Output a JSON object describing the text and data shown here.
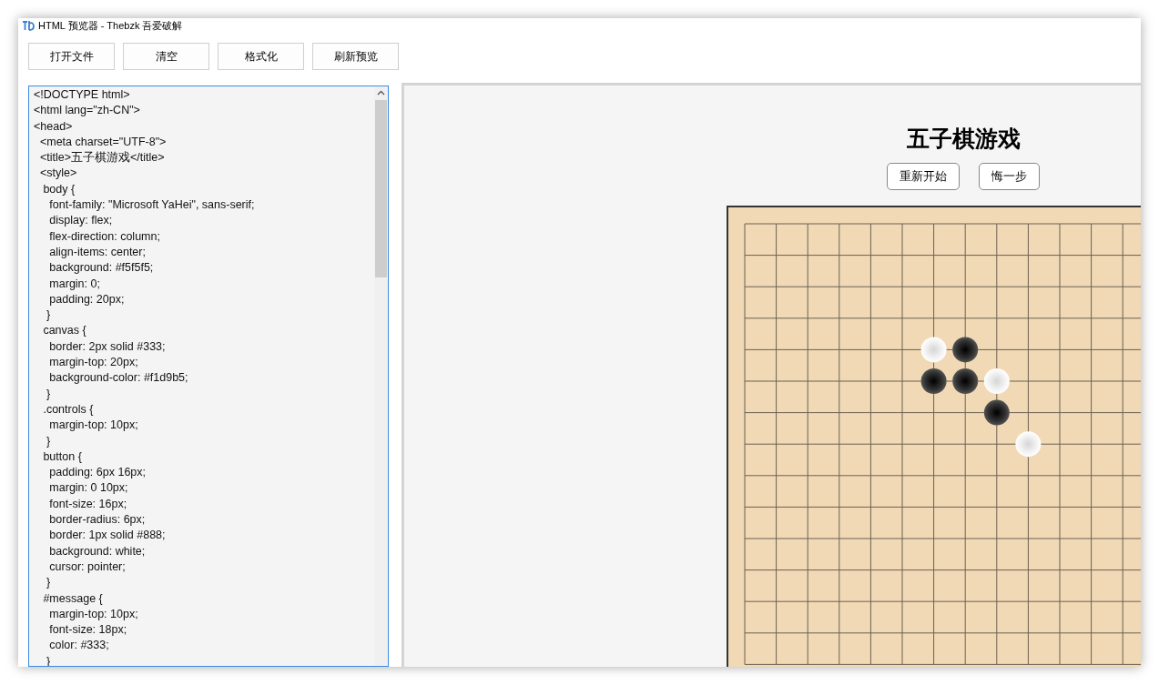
{
  "window": {
    "title": "HTML 预览器 - Thebzk 吾爱破解"
  },
  "toolbar": [
    "打开文件",
    "清空",
    "格式化",
    "刷新预览"
  ],
  "editor": {
    "lines": [
      "<!DOCTYPE html>",
      "<html lang=\"zh-CN\">",
      "<head>",
      "  <meta charset=\"UTF-8\">",
      "  <title>五子棋游戏</title>",
      "  <style>",
      "   body {",
      "     font-family: \"Microsoft YaHei\", sans-serif;",
      "     display: flex;",
      "     flex-direction: column;",
      "     align-items: center;",
      "     background: #f5f5f5;",
      "     margin: 0;",
      "     padding: 20px;",
      "    }",
      "   canvas {",
      "     border: 2px solid #333;",
      "     margin-top: 20px;",
      "     background-color: #f1d9b5;",
      "    }",
      "   .controls {",
      "     margin-top: 10px;",
      "    }",
      "   button {",
      "     padding: 6px 16px;",
      "     margin: 0 10px;",
      "     font-size: 16px;",
      "     border-radius: 6px;",
      "     border: 1px solid #888;",
      "     background: white;",
      "     cursor: pointer;",
      "    }",
      "   #message {",
      "     margin-top: 10px;",
      "     font-size: 18px;",
      "     color: #333;",
      "    }"
    ]
  },
  "preview": {
    "heading": "五子棋游戏",
    "buttons": [
      "重新开始",
      "悔一步"
    ],
    "board": [
      [
        {
          "kind": "empty"
        },
        {
          "kind": "empty"
        },
        {
          "kind": "empty"
        },
        {
          "kind": "empty"
        },
        {
          "kind": "empty"
        },
        {
          "kind": "empty"
        },
        {
          "kind": "empty"
        },
        {
          "kind": "empty"
        },
        {
          "kind": "empty"
        },
        {
          "kind": "empty"
        },
        {
          "kind": "empty"
        },
        {
          "kind": "empty"
        },
        {
          "kind": "empty"
        }
      ],
      [
        {
          "kind": "empty"
        },
        {
          "kind": "empty"
        },
        {
          "kind": "empty"
        },
        {
          "kind": "empty"
        },
        {
          "kind": "empty"
        },
        {
          "kind": "empty"
        },
        {
          "kind": "empty"
        },
        {
          "kind": "empty"
        },
        {
          "kind": "empty"
        },
        {
          "kind": "empty"
        },
        {
          "kind": "empty"
        },
        {
          "kind": "empty"
        },
        {
          "kind": "empty"
        }
      ],
      [
        {
          "kind": "empty"
        },
        {
          "kind": "empty"
        },
        {
          "kind": "empty"
        },
        {
          "kind": "empty"
        },
        {
          "kind": "empty"
        },
        {
          "kind": "empty"
        },
        {
          "kind": "empty"
        },
        {
          "kind": "empty"
        },
        {
          "kind": "empty"
        },
        {
          "kind": "empty"
        },
        {
          "kind": "empty"
        },
        {
          "kind": "empty"
        },
        {
          "kind": "empty"
        }
      ],
      [
        {
          "kind": "empty"
        },
        {
          "kind": "empty"
        },
        {
          "kind": "empty"
        },
        {
          "kind": "empty"
        },
        {
          "kind": "empty"
        },
        {
          "kind": "empty"
        },
        {
          "kind": "empty"
        },
        {
          "kind": "empty"
        },
        {
          "kind": "empty"
        },
        {
          "kind": "empty"
        },
        {
          "kind": "empty"
        },
        {
          "kind": "empty"
        },
        {
          "kind": "empty"
        }
      ],
      [
        {
          "kind": "empty"
        },
        {
          "kind": "empty"
        },
        {
          "kind": "empty"
        },
        {
          "kind": "empty"
        },
        {
          "kind": "empty"
        },
        {
          "kind": "empty"
        },
        {
          "kind": "white"
        },
        {
          "kind": "black"
        },
        {
          "kind": "empty"
        },
        {
          "kind": "empty"
        },
        {
          "kind": "empty"
        },
        {
          "kind": "empty"
        },
        {
          "kind": "empty"
        }
      ],
      [
        {
          "kind": "empty"
        },
        {
          "kind": "empty"
        },
        {
          "kind": "empty"
        },
        {
          "kind": "empty"
        },
        {
          "kind": "empty"
        },
        {
          "kind": "empty"
        },
        {
          "kind": "black"
        },
        {
          "kind": "black"
        },
        {
          "kind": "white"
        },
        {
          "kind": "empty"
        },
        {
          "kind": "empty"
        },
        {
          "kind": "empty"
        },
        {
          "kind": "empty"
        }
      ],
      [
        {
          "kind": "empty"
        },
        {
          "kind": "empty"
        },
        {
          "kind": "empty"
        },
        {
          "kind": "empty"
        },
        {
          "kind": "empty"
        },
        {
          "kind": "empty"
        },
        {
          "kind": "empty"
        },
        {
          "kind": "empty"
        },
        {
          "kind": "black"
        },
        {
          "kind": "empty"
        },
        {
          "kind": "empty"
        },
        {
          "kind": "empty"
        },
        {
          "kind": "empty"
        }
      ],
      [
        {
          "kind": "empty"
        },
        {
          "kind": "empty"
        },
        {
          "kind": "empty"
        },
        {
          "kind": "empty"
        },
        {
          "kind": "empty"
        },
        {
          "kind": "empty"
        },
        {
          "kind": "empty"
        },
        {
          "kind": "empty"
        },
        {
          "kind": "empty"
        },
        {
          "kind": "white"
        },
        {
          "kind": "empty"
        },
        {
          "kind": "empty"
        },
        {
          "kind": "empty"
        }
      ],
      [
        {
          "kind": "empty"
        },
        {
          "kind": "empty"
        },
        {
          "kind": "empty"
        },
        {
          "kind": "empty"
        },
        {
          "kind": "empty"
        },
        {
          "kind": "empty"
        },
        {
          "kind": "empty"
        },
        {
          "kind": "empty"
        },
        {
          "kind": "empty"
        },
        {
          "kind": "empty"
        },
        {
          "kind": "empty"
        },
        {
          "kind": "empty"
        },
        {
          "kind": "empty"
        }
      ],
      [
        {
          "kind": "empty"
        },
        {
          "kind": "empty"
        },
        {
          "kind": "empty"
        },
        {
          "kind": "empty"
        },
        {
          "kind": "empty"
        },
        {
          "kind": "empty"
        },
        {
          "kind": "empty"
        },
        {
          "kind": "empty"
        },
        {
          "kind": "empty"
        },
        {
          "kind": "empty"
        },
        {
          "kind": "empty"
        },
        {
          "kind": "empty"
        },
        {
          "kind": "empty"
        }
      ],
      [
        {
          "kind": "empty"
        },
        {
          "kind": "empty"
        },
        {
          "kind": "empty"
        },
        {
          "kind": "empty"
        },
        {
          "kind": "empty"
        },
        {
          "kind": "empty"
        },
        {
          "kind": "empty"
        },
        {
          "kind": "empty"
        },
        {
          "kind": "empty"
        },
        {
          "kind": "empty"
        },
        {
          "kind": "empty"
        },
        {
          "kind": "empty"
        },
        {
          "kind": "empty"
        }
      ],
      [
        {
          "kind": "empty"
        },
        {
          "kind": "empty"
        },
        {
          "kind": "empty"
        },
        {
          "kind": "empty"
        },
        {
          "kind": "empty"
        },
        {
          "kind": "empty"
        },
        {
          "kind": "empty"
        },
        {
          "kind": "empty"
        },
        {
          "kind": "empty"
        },
        {
          "kind": "empty"
        },
        {
          "kind": "empty"
        },
        {
          "kind": "empty"
        },
        {
          "kind": "empty"
        }
      ],
      [
        {
          "kind": "empty"
        },
        {
          "kind": "empty"
        },
        {
          "kind": "empty"
        },
        {
          "kind": "empty"
        },
        {
          "kind": "empty"
        },
        {
          "kind": "empty"
        },
        {
          "kind": "empty"
        },
        {
          "kind": "empty"
        },
        {
          "kind": "empty"
        },
        {
          "kind": "empty"
        },
        {
          "kind": "empty"
        },
        {
          "kind": "empty"
        },
        {
          "kind": "empty"
        }
      ],
      [
        {
          "kind": "empty"
        },
        {
          "kind": "empty"
        },
        {
          "kind": "empty"
        },
        {
          "kind": "empty"
        },
        {
          "kind": "empty"
        },
        {
          "kind": "empty"
        },
        {
          "kind": "empty"
        },
        {
          "kind": "empty"
        },
        {
          "kind": "empty"
        },
        {
          "kind": "empty"
        },
        {
          "kind": "empty"
        },
        {
          "kind": "empty"
        },
        {
          "kind": "empty"
        }
      ]
    ]
  }
}
